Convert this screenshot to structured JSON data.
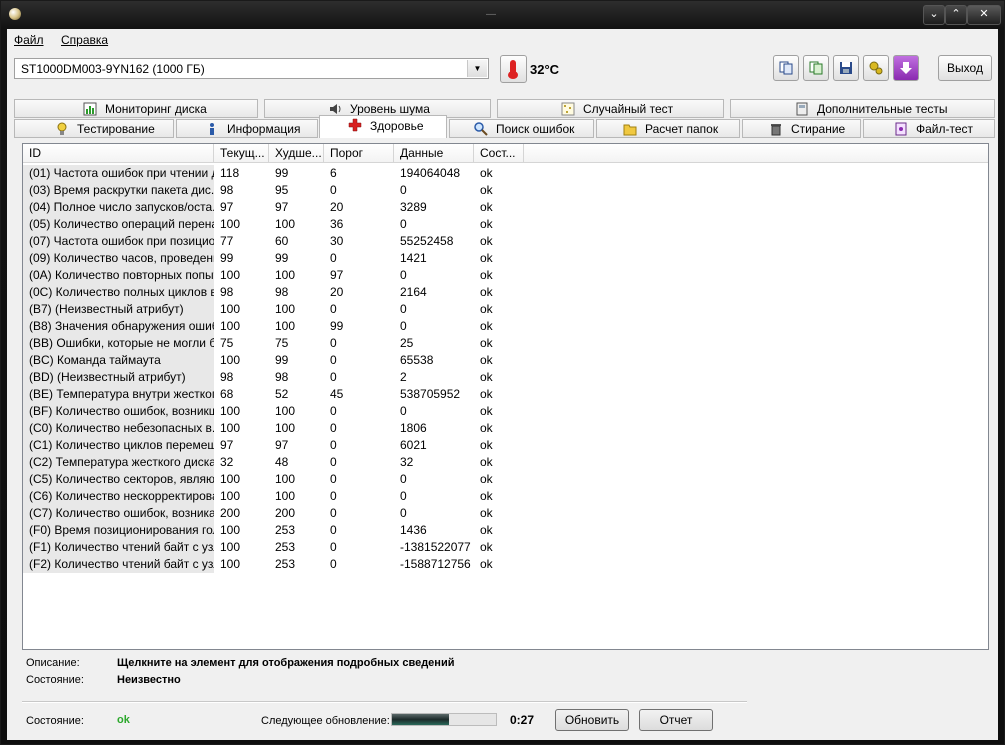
{
  "window": {
    "title": "—"
  },
  "menu": {
    "file": "Файл",
    "help": "Справка"
  },
  "drive": {
    "selected": "ST1000DM003-9YN162 (1000 ГБ)",
    "temperature": "32°C"
  },
  "toolbar": {
    "exit_label": "Выход"
  },
  "tabs_row1": [
    {
      "label": "Мониторинг диска",
      "icon": "chart-icon"
    },
    {
      "label": "Уровень шума",
      "icon": "speaker-icon"
    },
    {
      "label": "Случайный тест",
      "icon": "dots-icon"
    },
    {
      "label": "Дополнительные тесты",
      "icon": "calculator-icon"
    }
  ],
  "tabs_row2": [
    {
      "label": "Тестирование",
      "icon": "bulb-icon"
    },
    {
      "label": "Информация",
      "icon": "info-icon"
    },
    {
      "label": "Здоровье",
      "icon": "red-cross-icon"
    },
    {
      "label": "Поиск ошибок",
      "icon": "magnifier-icon"
    },
    {
      "label": "Расчет папок",
      "icon": "folder-icon"
    },
    {
      "label": "Стирание",
      "icon": "trash-icon"
    },
    {
      "label": "Файл-тест",
      "icon": "file-test-icon"
    }
  ],
  "columns": [
    "ID",
    "Текущ...",
    "Худше...",
    "Порог",
    "Данные",
    "Сост..."
  ],
  "rows": [
    [
      "(01) Частота ошибок при чтении д...",
      "118",
      "99",
      "6",
      "194064048",
      "ok"
    ],
    [
      "(03) Время раскрутки пакета дис...",
      "98",
      "95",
      "0",
      "0",
      "ok"
    ],
    [
      "(04) Полное число запусков/оста...",
      "97",
      "97",
      "20",
      "3289",
      "ok"
    ],
    [
      "(05) Количество операций перена...",
      "100",
      "100",
      "36",
      "0",
      "ok"
    ],
    [
      "(07) Частота ошибок при позицио...",
      "77",
      "60",
      "30",
      "55252458",
      "ok"
    ],
    [
      "(09) Количество часов, проведенн...",
      "99",
      "99",
      "0",
      "1421",
      "ok"
    ],
    [
      "(0A) Количество повторных попыт...",
      "100",
      "100",
      "97",
      "0",
      "ok"
    ],
    [
      "(0C) Количество полных циклов в...",
      "98",
      "98",
      "20",
      "2164",
      "ok"
    ],
    [
      "(B7) (Неизвестный атрибут)",
      "100",
      "100",
      "0",
      "0",
      "ok"
    ],
    [
      "(B8) Значения обнаружения ошиб...",
      "100",
      "100",
      "99",
      "0",
      "ok"
    ],
    [
      "(BB) Ошибки, которые не могли б...",
      "75",
      "75",
      "0",
      "25",
      "ok"
    ],
    [
      "(BC) Команда таймаута",
      "100",
      "99",
      "0",
      "65538",
      "ok"
    ],
    [
      "(BD) (Неизвестный атрибут)",
      "98",
      "98",
      "0",
      "2",
      "ok"
    ],
    [
      "(BE) Температура внутри жестког...",
      "68",
      "52",
      "45",
      "538705952",
      "ok"
    ],
    [
      "(BF) Количество ошибок, возникш...",
      "100",
      "100",
      "0",
      "0",
      "ok"
    ],
    [
      "(C0) Количество небезопасных в...",
      "100",
      "100",
      "0",
      "1806",
      "ok"
    ],
    [
      "(C1) Количество циклов перемещ...",
      "97",
      "97",
      "0",
      "6021",
      "ok"
    ],
    [
      "(C2) Температура жесткого диска",
      "32",
      "48",
      "0",
      "32",
      "ok"
    ],
    [
      "(C5) Количество секторов, являю...",
      "100",
      "100",
      "0",
      "0",
      "ok"
    ],
    [
      "(C6) Количество нескорректирова...",
      "100",
      "100",
      "0",
      "0",
      "ok"
    ],
    [
      "(C7) Количество ошибок, возника...",
      "200",
      "200",
      "0",
      "0",
      "ok"
    ],
    [
      "(F0) Время позиционирования гол...",
      "100",
      "253",
      "0",
      "1436",
      "ok"
    ],
    [
      "(F1) Количество чтений байт с узл...",
      "100",
      "253",
      "0",
      "-1381522077",
      "ok"
    ],
    [
      "(F2) Количество чтений байт с узл...",
      "100",
      "253",
      "0",
      "-1588712756",
      "ok"
    ]
  ],
  "details": {
    "description_label": "Описание:",
    "description_value": "Щелкните на элемент для отображения подробных сведений",
    "state_label": "Состояние:",
    "state_value": "Неизвестно"
  },
  "footer": {
    "status_label": "Состояние:",
    "status_value": "ok",
    "status_color": "#2ca82c",
    "next_update_label": "Следующее обновление:",
    "progress_fraction": 0.55,
    "timer": "0:27",
    "refresh_label": "Обновить",
    "report_label": "Отчет"
  }
}
